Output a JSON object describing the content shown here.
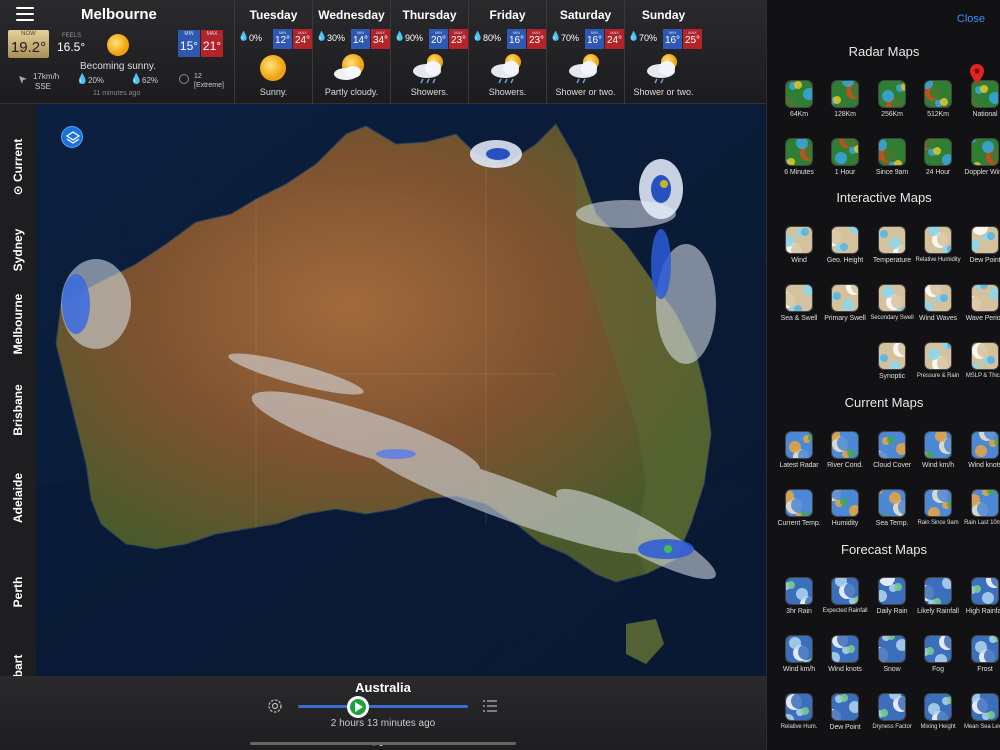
{
  "location": {
    "city": "Melbourne"
  },
  "current": {
    "now_label": "NOW",
    "temp": "19.2°",
    "feels_label": "FEELS",
    "feels": "16.5°",
    "condition": "Becoming sunny.",
    "min_label": "MIN",
    "min": "15°",
    "max_label": "MAX",
    "max": "21°",
    "wind_speed": "17km/h",
    "wind_dir": "SSE",
    "rain_chance": "20%",
    "humidity": "62%",
    "uv_index": "12",
    "uv_level": "[Extreme]",
    "updated": "11 minutes ago"
  },
  "forecast": [
    {
      "day": "Tuesday",
      "rain": "0%",
      "min": "12°",
      "max": "24°",
      "condition": "Sunny.",
      "icon": "sun-icon"
    },
    {
      "day": "Wednesday",
      "rain": "30%",
      "min": "14°",
      "max": "34°",
      "condition": "Partly cloudy.",
      "icon": "partly-cloudy-icon"
    },
    {
      "day": "Thursday",
      "rain": "90%",
      "min": "20°",
      "max": "23°",
      "condition": "Showers.",
      "icon": "showers-icon"
    },
    {
      "day": "Friday",
      "rain": "80%",
      "min": "16°",
      "max": "23°",
      "condition": "Showers.",
      "icon": "showers-icon"
    },
    {
      "day": "Saturday",
      "rain": "70%",
      "min": "16°",
      "max": "24°",
      "condition": "Shower or two.",
      "icon": "shower-icon"
    },
    {
      "day": "Sunday",
      "rain": "70%",
      "min": "16°",
      "max": "25°",
      "condition": "Shower or two.",
      "icon": "shower-icon"
    }
  ],
  "forecast_min_label": "MIN",
  "forecast_max_label": "MAX",
  "side_tabs": [
    "⊙ Current",
    "Sydney",
    "Melbourne",
    "Brisbane",
    "Adelaide",
    "Perth",
    "Hobart"
  ],
  "bottom": {
    "region": "Australia",
    "time_ago": "2 hours 13 minutes ago",
    "timeline_progress": 0.35
  },
  "panel": {
    "close": "Close",
    "sections": [
      {
        "title": "Radar Maps",
        "items": [
          "64Km",
          "128Km",
          "256Km",
          "512Km",
          "National",
          "6 Minutes",
          "1 Hour",
          "Since 9am",
          "24 Hour",
          "Doppler Wind"
        ]
      },
      {
        "title": "Interactive Maps",
        "items": [
          "Wind",
          "Geo. Height",
          "Temperature",
          "Relative Humidity",
          "Dew Point",
          "Sea & Swell",
          "Primary Swell",
          "Secondary Swell",
          "Wind Waves",
          "Wave Period",
          "Synoptic",
          "Pressure & Rain",
          "MSLP & Thick."
        ]
      },
      {
        "title": "Current Maps",
        "items": [
          "Latest Radar",
          "River Cond.",
          "Cloud Cover",
          "Wind km/h",
          "Wind knots",
          "Current Temp.",
          "Humidity",
          "Sea Temp.",
          "Rain Since 9am",
          "Rain Last 10min"
        ]
      },
      {
        "title": "Forecast Maps",
        "items": [
          "3hr Rain",
          "Expected Rainfall",
          "Daily Rain",
          "Likely Rainfall",
          "High Rainfall",
          "Wind km/h",
          "Wind knots",
          "Snow",
          "Fog",
          "Frost",
          "Relative Hum.",
          "Dew Point",
          "Dryness Factor",
          "Mixing Height",
          "Mean Sea Level"
        ]
      }
    ]
  },
  "colors": {
    "accent": "#3a8fff",
    "min": "#2f58b2",
    "max": "#b3232a",
    "play": "#19a33b"
  }
}
